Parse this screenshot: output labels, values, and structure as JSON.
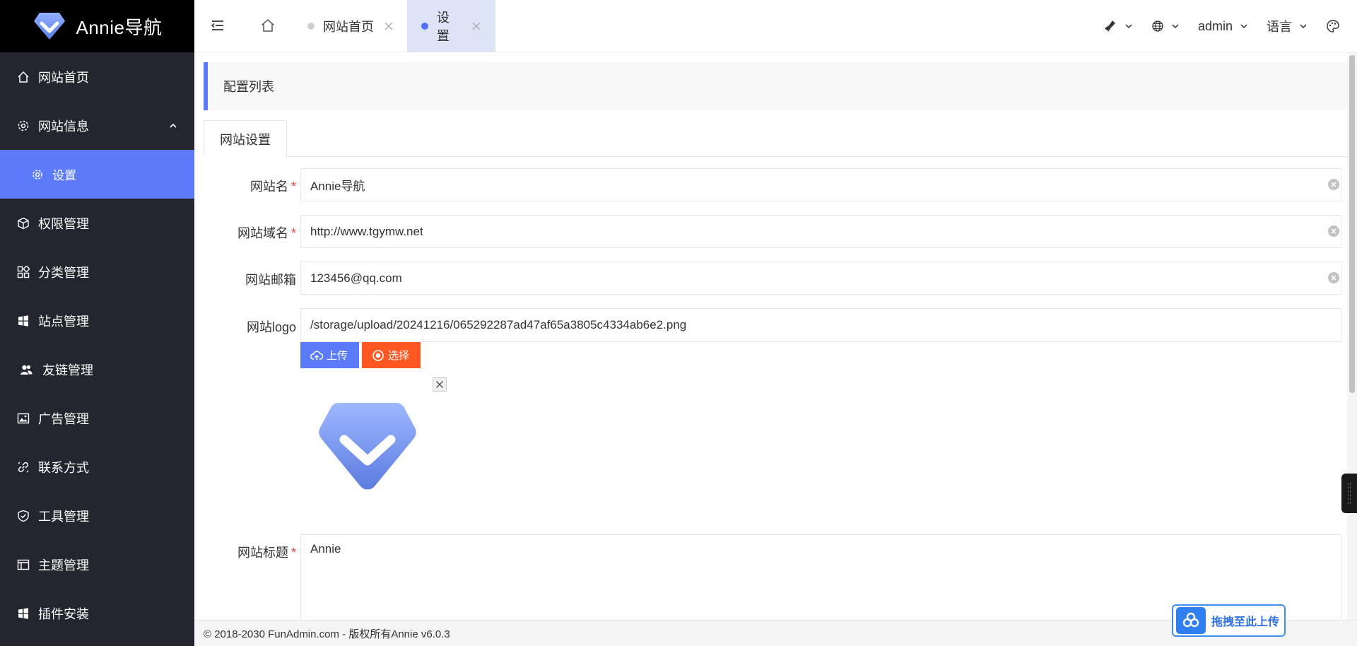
{
  "brand": {
    "name": "Annie导航",
    "accent": "#5b7bfa"
  },
  "sidebar": {
    "items": [
      {
        "label": "网站首页",
        "icon": "home-icon"
      },
      {
        "label": "网站信息",
        "icon": "gear-icon",
        "expanded": true
      },
      {
        "label": "设置",
        "icon": "gear-icon",
        "active": true,
        "sub": true
      },
      {
        "label": "权限管理",
        "icon": "cube-icon"
      },
      {
        "label": "分类管理",
        "icon": "grid-icon"
      },
      {
        "label": "站点管理",
        "icon": "windows-icon"
      },
      {
        "label": "友链管理",
        "icon": "users-icon"
      },
      {
        "label": "广告管理",
        "icon": "image-icon"
      },
      {
        "label": "联系方式",
        "icon": "link-icon"
      },
      {
        "label": "工具管理",
        "icon": "shield-icon"
      },
      {
        "label": "主题管理",
        "icon": "layout-icon"
      },
      {
        "label": "插件安装",
        "icon": "windows-icon"
      }
    ]
  },
  "header": {
    "tabs": [
      {
        "label": "网站首页"
      },
      {
        "label": "设置",
        "active": true
      }
    ],
    "user": "admin",
    "language": "语言"
  },
  "main": {
    "panel_title": "配置列表",
    "form_tab": "网站设置",
    "fields": {
      "site_name": {
        "label": "网站名",
        "value": "Annie导航",
        "required": true
      },
      "site_domain": {
        "label": "网站域名",
        "value": "http://www.tgymw.net",
        "required": true
      },
      "site_email": {
        "label": "网站邮箱",
        "value": "123456@qq.com",
        "required": false
      },
      "site_logo": {
        "label": "网站logo",
        "value": "/storage/upload/20241216/065292287ad47af65a3805c4334ab6e2.png",
        "required": false
      },
      "site_title": {
        "label": "网站标题",
        "value": "Annie",
        "required": true
      }
    },
    "upload_label": "上传",
    "choose_label": "选择",
    "required_mark": "*"
  },
  "footer": {
    "text": "© 2018-2030 FunAdmin.com - 版权所有Annie v6.0.3"
  },
  "drag_upload": {
    "label": "拖拽至此上传"
  }
}
